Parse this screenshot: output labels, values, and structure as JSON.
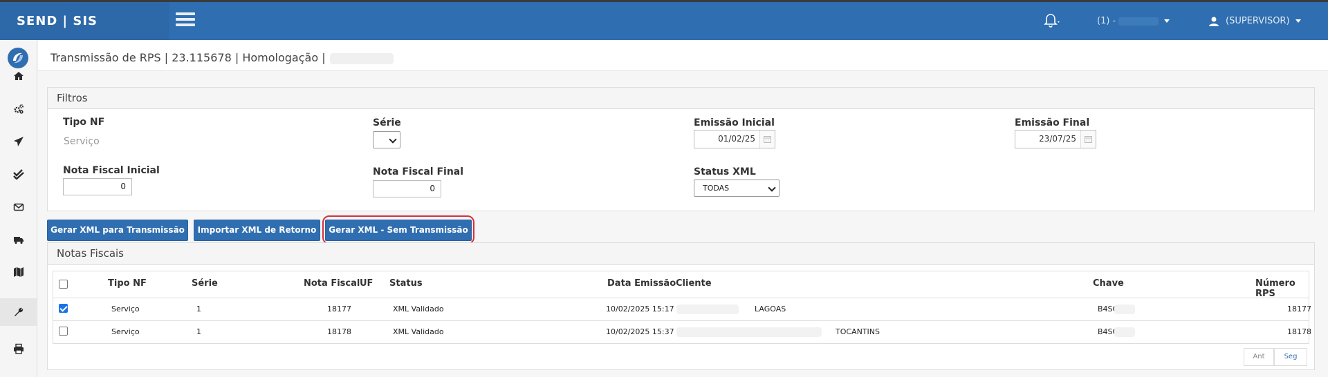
{
  "header": {
    "brand": "SEND | SIS",
    "env_label": "(1) -",
    "user_label": "(SUPERVISOR)"
  },
  "breadcrumb": "Transmissão de RPS | 23.115678 | Homologação |",
  "filters": {
    "title": "Filtros",
    "tipo_nf_label": "Tipo NF",
    "tipo_nf_value": "Serviço",
    "serie_label": "Série",
    "serie_value": "",
    "emissao_inicial_label": "Emissão Inicial",
    "emissao_inicial_value": "01/02/25",
    "emissao_final_label": "Emissão Final",
    "emissao_final_value": "23/07/25",
    "nf_inicial_label": "Nota Fiscal Inicial",
    "nf_inicial_value": "0",
    "nf_final_label": "Nota Fiscal Final",
    "nf_final_value": "0",
    "status_xml_label": "Status XML",
    "status_xml_value": "TODAS"
  },
  "actions": {
    "gerar_xml": "Gerar XML para Transmissão",
    "importar_xml": "Importar XML de Retorno",
    "gerar_sem": "Gerar XML - Sem Transmissão"
  },
  "notas": {
    "title": "Notas Fiscais",
    "columns": {
      "tipo_nf": "Tipo NF",
      "serie": "Série",
      "nota_fiscal": "Nota Fiscal",
      "uf": "UF",
      "status": "Status",
      "data_emissao": "Data Emissão",
      "cliente": "Cliente",
      "chave": "Chave",
      "numero_rps": "Número RPS"
    },
    "rows": [
      {
        "checked": true,
        "tipo_nf": "Serviço",
        "serie": "1",
        "nota_fiscal": "18177",
        "status": "XML Validado",
        "data_emissao": "10/02/2025 15:17",
        "cliente": "LAGOAS",
        "chave": "B4SQ",
        "numero_rps": "18177"
      },
      {
        "checked": false,
        "tipo_nf": "Serviço",
        "serie": "1",
        "nota_fiscal": "18178",
        "status": "XML Validado",
        "data_emissao": "10/02/2025 15:37",
        "cliente": "TOCANTINS",
        "chave": "B4SQ",
        "numero_rps": "18178"
      }
    ],
    "pager": {
      "prev": "Ant",
      "next": "Seg"
    }
  },
  "icons": {
    "sidebar": [
      "home-icon",
      "cogs-icon",
      "send-icon",
      "check-double-icon",
      "envelope-icon",
      "truck-icon",
      "map-icon",
      "wrench-icon",
      "print-icon"
    ]
  },
  "colors": {
    "primary": "#2f6eb0",
    "highlight": "#d6303b"
  }
}
